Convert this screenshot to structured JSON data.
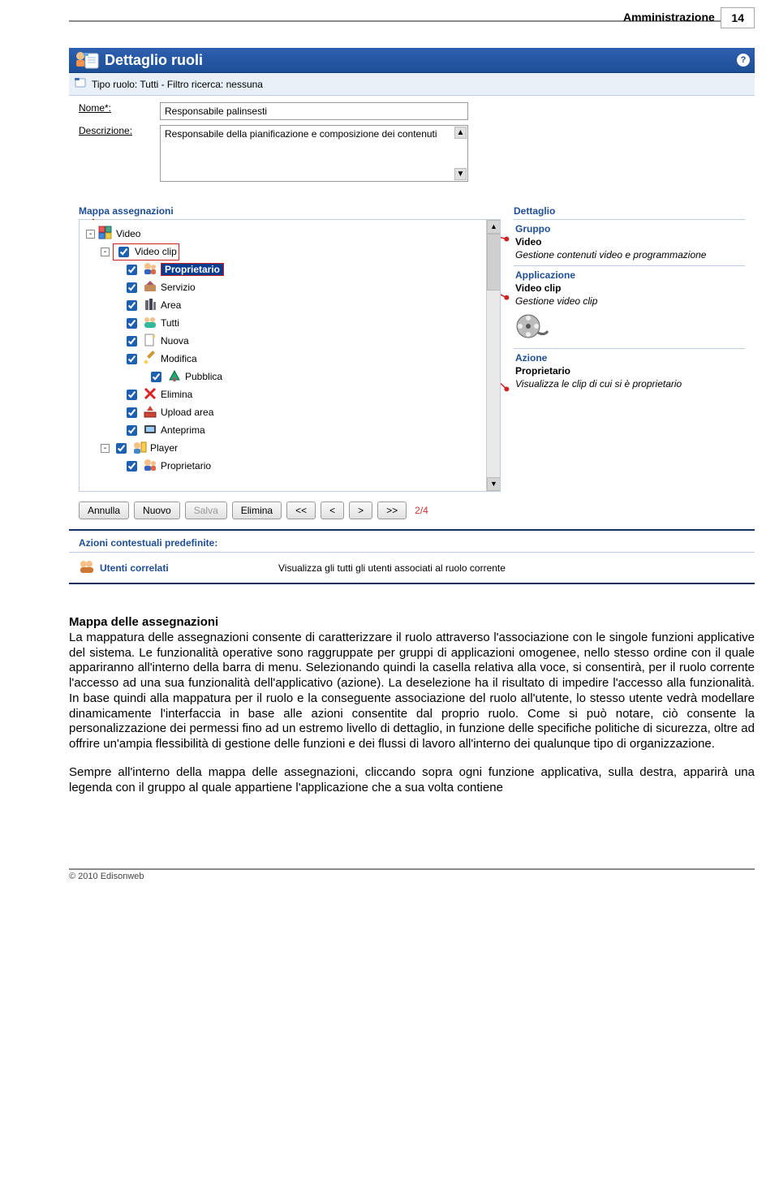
{
  "page": {
    "header_label": "Amministrazione",
    "page_number": "14"
  },
  "titlebar": {
    "title": "Dettaglio ruoli",
    "help": "?"
  },
  "filterbar": {
    "text": "Tipo ruolo: Tutti - Filtro ricerca: nessuna"
  },
  "form": {
    "name_label": "Nome*:",
    "name_value": "Responsabile palinsesti",
    "desc_label": "Descrizione:",
    "desc_value": "Responsabile della pianificazione e composizione dei contenuti"
  },
  "tree": {
    "header": "Mappa assegnazioni",
    "nodes": {
      "video": "Video",
      "video_clip": "Video clip",
      "proprietario": "Proprietario",
      "servizio": "Servizio",
      "area": "Area",
      "tutti": "Tutti",
      "nuova": "Nuova",
      "modifica": "Modifica",
      "pubblica": "Pubblica",
      "elimina": "Elimina",
      "upload_area": "Upload area",
      "anteprima": "Anteprima",
      "player": "Player",
      "player_proprietario": "Proprietario"
    },
    "expander_minus": "-"
  },
  "detail": {
    "header": "Dettaglio",
    "gruppo": {
      "h": "Gruppo",
      "t": "Video",
      "d": "Gestione contenuti video e programmazione"
    },
    "applicazione": {
      "h": "Applicazione",
      "t": "Video clip",
      "d": "Gestione video clip"
    },
    "azione": {
      "h": "Azione",
      "t": "Proprietario",
      "d": "Visualizza le clip di cui si è proprietario"
    }
  },
  "buttons": {
    "annulla": "Annulla",
    "nuovo": "Nuovo",
    "salva": "Salva",
    "elimina": "Elimina",
    "first": "<<",
    "prev": "<",
    "next": ">",
    "last": ">>",
    "pager": "2/4"
  },
  "context": {
    "header": "Azioni contestuali predefinite:",
    "action_title": "Utenti correlati",
    "action_desc": "Visualizza gli tutti gli utenti associati al ruolo corrente"
  },
  "body": {
    "title": "Mappa delle assegnazioni",
    "p1": "La mappatura delle assegnazioni consente di caratterizzare il ruolo attraverso l'associazione con le singole funzioni applicative del sistema. Le funzionalità operative sono raggruppate per gruppi di applicazioni omogenee, nello stesso ordine con il quale appariranno all'interno della barra di menu. Selezionando quindi la casella relativa alla voce, si consentirà, per il ruolo corrente l'accesso ad una sua funzionalità dell'applicativo (azione). La deselezione ha il risultato di impedire l'accesso alla funzionalità. In base quindi alla mappatura per il ruolo e la conseguente associazione del ruolo all'utente, lo stesso utente vedrà modellare dinamicamente l'interfaccia in base alle azioni consentite dal proprio ruolo. Come si può notare, ciò consente la  personalizzazione dei permessi fino ad un estremo livello di dettaglio, in funzione delle specifiche politiche di sicurezza, oltre ad offrire un'ampia flessibilità di gestione delle funzioni e dei flussi di lavoro all'interno dei qualunque tipo di organizzazione.",
    "p2": "Sempre all'interno della mappa delle assegnazioni, cliccando sopra ogni funzione applicativa, sulla destra, apparirà una legenda con il gruppo al quale appartiene l'applicazione che a sua volta contiene"
  },
  "footer": {
    "copyright": "© 2010 Edisonweb"
  }
}
